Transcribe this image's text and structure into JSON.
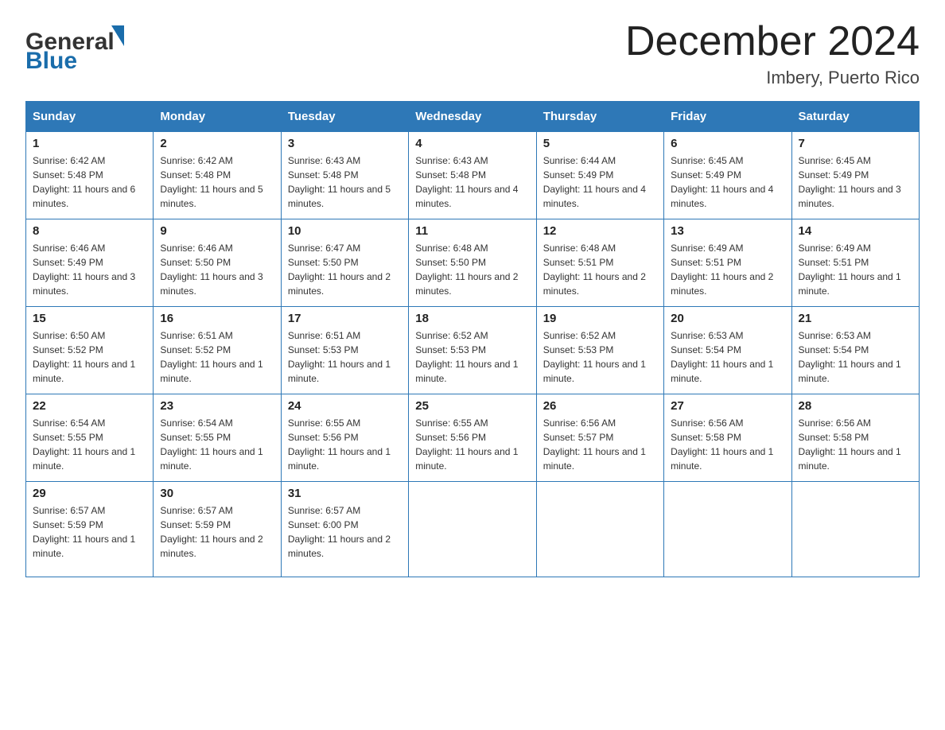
{
  "header": {
    "logo_general": "General",
    "logo_blue": "Blue",
    "month_title": "December 2024",
    "location": "Imbery, Puerto Rico"
  },
  "days_of_week": [
    "Sunday",
    "Monday",
    "Tuesday",
    "Wednesday",
    "Thursday",
    "Friday",
    "Saturday"
  ],
  "weeks": [
    [
      {
        "day": "1",
        "sunrise": "Sunrise: 6:42 AM",
        "sunset": "Sunset: 5:48 PM",
        "daylight": "Daylight: 11 hours and 6 minutes."
      },
      {
        "day": "2",
        "sunrise": "Sunrise: 6:42 AM",
        "sunset": "Sunset: 5:48 PM",
        "daylight": "Daylight: 11 hours and 5 minutes."
      },
      {
        "day": "3",
        "sunrise": "Sunrise: 6:43 AM",
        "sunset": "Sunset: 5:48 PM",
        "daylight": "Daylight: 11 hours and 5 minutes."
      },
      {
        "day": "4",
        "sunrise": "Sunrise: 6:43 AM",
        "sunset": "Sunset: 5:48 PM",
        "daylight": "Daylight: 11 hours and 4 minutes."
      },
      {
        "day": "5",
        "sunrise": "Sunrise: 6:44 AM",
        "sunset": "Sunset: 5:49 PM",
        "daylight": "Daylight: 11 hours and 4 minutes."
      },
      {
        "day": "6",
        "sunrise": "Sunrise: 6:45 AM",
        "sunset": "Sunset: 5:49 PM",
        "daylight": "Daylight: 11 hours and 4 minutes."
      },
      {
        "day": "7",
        "sunrise": "Sunrise: 6:45 AM",
        "sunset": "Sunset: 5:49 PM",
        "daylight": "Daylight: 11 hours and 3 minutes."
      }
    ],
    [
      {
        "day": "8",
        "sunrise": "Sunrise: 6:46 AM",
        "sunset": "Sunset: 5:49 PM",
        "daylight": "Daylight: 11 hours and 3 minutes."
      },
      {
        "day": "9",
        "sunrise": "Sunrise: 6:46 AM",
        "sunset": "Sunset: 5:50 PM",
        "daylight": "Daylight: 11 hours and 3 minutes."
      },
      {
        "day": "10",
        "sunrise": "Sunrise: 6:47 AM",
        "sunset": "Sunset: 5:50 PM",
        "daylight": "Daylight: 11 hours and 2 minutes."
      },
      {
        "day": "11",
        "sunrise": "Sunrise: 6:48 AM",
        "sunset": "Sunset: 5:50 PM",
        "daylight": "Daylight: 11 hours and 2 minutes."
      },
      {
        "day": "12",
        "sunrise": "Sunrise: 6:48 AM",
        "sunset": "Sunset: 5:51 PM",
        "daylight": "Daylight: 11 hours and 2 minutes."
      },
      {
        "day": "13",
        "sunrise": "Sunrise: 6:49 AM",
        "sunset": "Sunset: 5:51 PM",
        "daylight": "Daylight: 11 hours and 2 minutes."
      },
      {
        "day": "14",
        "sunrise": "Sunrise: 6:49 AM",
        "sunset": "Sunset: 5:51 PM",
        "daylight": "Daylight: 11 hours and 1 minute."
      }
    ],
    [
      {
        "day": "15",
        "sunrise": "Sunrise: 6:50 AM",
        "sunset": "Sunset: 5:52 PM",
        "daylight": "Daylight: 11 hours and 1 minute."
      },
      {
        "day": "16",
        "sunrise": "Sunrise: 6:51 AM",
        "sunset": "Sunset: 5:52 PM",
        "daylight": "Daylight: 11 hours and 1 minute."
      },
      {
        "day": "17",
        "sunrise": "Sunrise: 6:51 AM",
        "sunset": "Sunset: 5:53 PM",
        "daylight": "Daylight: 11 hours and 1 minute."
      },
      {
        "day": "18",
        "sunrise": "Sunrise: 6:52 AM",
        "sunset": "Sunset: 5:53 PM",
        "daylight": "Daylight: 11 hours and 1 minute."
      },
      {
        "day": "19",
        "sunrise": "Sunrise: 6:52 AM",
        "sunset": "Sunset: 5:53 PM",
        "daylight": "Daylight: 11 hours and 1 minute."
      },
      {
        "day": "20",
        "sunrise": "Sunrise: 6:53 AM",
        "sunset": "Sunset: 5:54 PM",
        "daylight": "Daylight: 11 hours and 1 minute."
      },
      {
        "day": "21",
        "sunrise": "Sunrise: 6:53 AM",
        "sunset": "Sunset: 5:54 PM",
        "daylight": "Daylight: 11 hours and 1 minute."
      }
    ],
    [
      {
        "day": "22",
        "sunrise": "Sunrise: 6:54 AM",
        "sunset": "Sunset: 5:55 PM",
        "daylight": "Daylight: 11 hours and 1 minute."
      },
      {
        "day": "23",
        "sunrise": "Sunrise: 6:54 AM",
        "sunset": "Sunset: 5:55 PM",
        "daylight": "Daylight: 11 hours and 1 minute."
      },
      {
        "day": "24",
        "sunrise": "Sunrise: 6:55 AM",
        "sunset": "Sunset: 5:56 PM",
        "daylight": "Daylight: 11 hours and 1 minute."
      },
      {
        "day": "25",
        "sunrise": "Sunrise: 6:55 AM",
        "sunset": "Sunset: 5:56 PM",
        "daylight": "Daylight: 11 hours and 1 minute."
      },
      {
        "day": "26",
        "sunrise": "Sunrise: 6:56 AM",
        "sunset": "Sunset: 5:57 PM",
        "daylight": "Daylight: 11 hours and 1 minute."
      },
      {
        "day": "27",
        "sunrise": "Sunrise: 6:56 AM",
        "sunset": "Sunset: 5:58 PM",
        "daylight": "Daylight: 11 hours and 1 minute."
      },
      {
        "day": "28",
        "sunrise": "Sunrise: 6:56 AM",
        "sunset": "Sunset: 5:58 PM",
        "daylight": "Daylight: 11 hours and 1 minute."
      }
    ],
    [
      {
        "day": "29",
        "sunrise": "Sunrise: 6:57 AM",
        "sunset": "Sunset: 5:59 PM",
        "daylight": "Daylight: 11 hours and 1 minute."
      },
      {
        "day": "30",
        "sunrise": "Sunrise: 6:57 AM",
        "sunset": "Sunset: 5:59 PM",
        "daylight": "Daylight: 11 hours and 2 minutes."
      },
      {
        "day": "31",
        "sunrise": "Sunrise: 6:57 AM",
        "sunset": "Sunset: 6:00 PM",
        "daylight": "Daylight: 11 hours and 2 minutes."
      },
      null,
      null,
      null,
      null
    ]
  ]
}
